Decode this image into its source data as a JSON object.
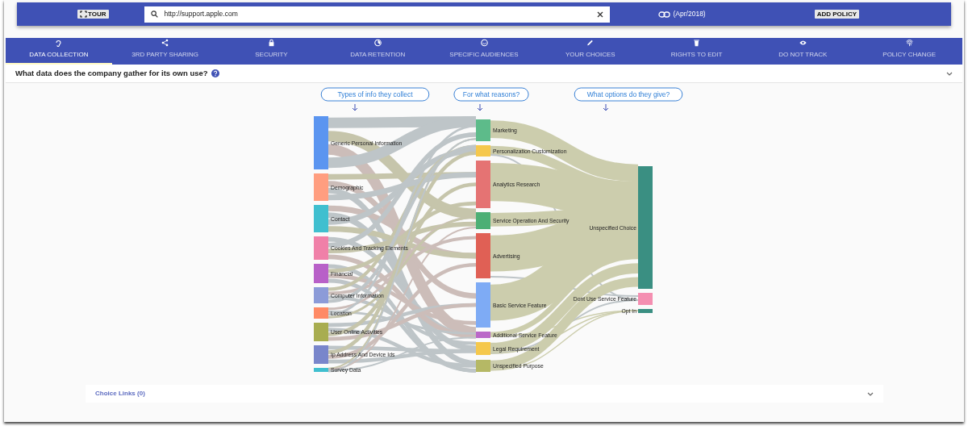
{
  "toolbar": {
    "tour_button": "TOUR",
    "url_field": {
      "value": "http://support.apple.com"
    },
    "policy_date": "(Apr/2018)",
    "add_policy_button": "ADD POLICY"
  },
  "tabs": [
    {
      "label": "DATA COLLECTION",
      "selected": true
    },
    {
      "label": "3RD PARTY SHARING",
      "selected": false
    },
    {
      "label": "SECURITY",
      "selected": false
    },
    {
      "label": "DATA RETENTION",
      "selected": false
    },
    {
      "label": "SPECIFIC AUDIENCES",
      "selected": false
    },
    {
      "label": "YOUR CHOICES",
      "selected": false
    },
    {
      "label": "RIGHTS TO EDIT",
      "selected": false
    },
    {
      "label": "DO NOT TRACK",
      "selected": false
    },
    {
      "label": "POLICY CHANGE",
      "selected": false
    }
  ],
  "question": {
    "text": "What data does the company gather for its own use?"
  },
  "sankey": {
    "column_headings": [
      "Types of info they collect",
      "For what reasons?",
      "What options do they give?"
    ],
    "columns": [
      {
        "nodes": [
          {
            "label": "Generic Personal Information",
            "color": "#5b95f0"
          },
          {
            "label": "Demographic",
            "color": "#ff9e80"
          },
          {
            "label": "Contact",
            "color": "#40bfcf"
          },
          {
            "label": "Cookies And Tracking Elements",
            "color": "#f080a8"
          },
          {
            "label": "Financial",
            "color": "#b860c8"
          },
          {
            "label": "Computer Information",
            "color": "#8c9bd8"
          },
          {
            "label": "Location",
            "color": "#ff8a65"
          },
          {
            "label": "User Online Activities",
            "color": "#a8ad50"
          },
          {
            "label": "Ip Address And Device Ids",
            "color": "#7986cb"
          },
          {
            "label": "Survey Data",
            "color": "#40bfcf"
          }
        ]
      },
      {
        "nodes": [
          {
            "label": "Marketing",
            "color": "#5dbb8a"
          },
          {
            "label": "Personalization Customization",
            "color": "#f5c84c"
          },
          {
            "label": "Analytics Research",
            "color": "#e57373"
          },
          {
            "label": "Service Operation And Security",
            "color": "#4caf75"
          },
          {
            "label": "Advertising",
            "color": "#e06055"
          },
          {
            "label": "Basic Service Feature",
            "color": "#7eabf5"
          },
          {
            "label": "Additional Service Feature",
            "color": "#ba68c8"
          },
          {
            "label": "Legal Requirement",
            "color": "#f5c84c"
          },
          {
            "label": "Unspecified Purpose",
            "color": "#b5b865"
          }
        ]
      },
      {
        "nodes": [
          {
            "label": "Unspecified Choice",
            "color": "#3a8f82"
          },
          {
            "label": "Dont Use Service Feature",
            "color": "#f48fb1"
          },
          {
            "label": "Opt In",
            "color": "#3a8f82"
          }
        ]
      }
    ]
  },
  "choice_links": {
    "title": "Choice Links (0)"
  }
}
